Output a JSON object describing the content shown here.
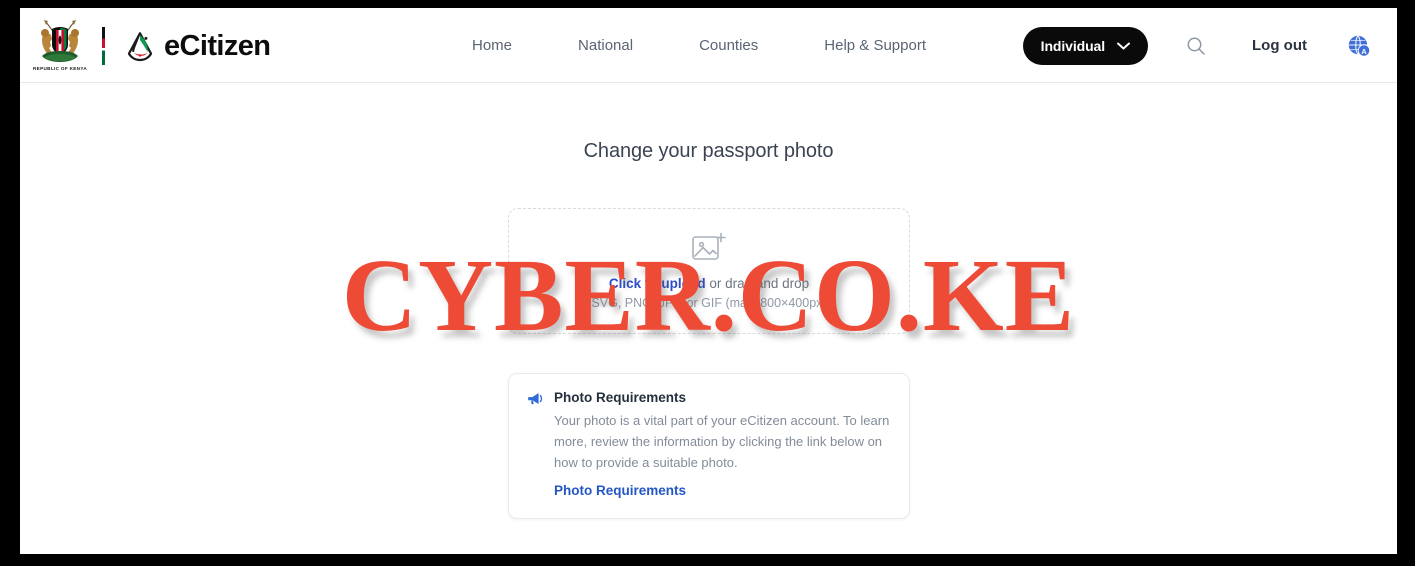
{
  "brand": {
    "coat_caption": "REPUBLIC OF KENYA",
    "wordmark": "eCitizen"
  },
  "nav": {
    "items": [
      {
        "label": "Home"
      },
      {
        "label": "National"
      },
      {
        "label": "Counties"
      },
      {
        "label": "Help & Support"
      }
    ]
  },
  "header_right": {
    "account_type": "Individual",
    "chevron_icon": "chevron-down-icon",
    "search_icon": "search-icon",
    "logout_label": "Log out",
    "globe_icon": "globe-translate-icon"
  },
  "main": {
    "title": "Change your passport photo"
  },
  "dropzone": {
    "icon": "image-add-icon",
    "link_text": "Click to upload",
    "rest_text": " or drag and drop",
    "formats": "SVG, PNG, JPG or GIF (max. 800×400px)"
  },
  "requirements": {
    "icon": "megaphone-icon",
    "title": "Photo Requirements",
    "body": "Your photo is a vital part of your eCitizen account. To learn more, review the information by clicking the link below on how to provide a suitable photo.",
    "link_label": "Photo Requirements"
  },
  "watermark": {
    "text": "CYBER.CO.KE",
    "color": "#ee4b37"
  },
  "colors": {
    "accent_blue": "#2b4cc8",
    "link_blue": "#2457c5",
    "pill_black": "#0a0a0a",
    "text_muted": "#828c99",
    "watermark_red": "#ee4b37"
  }
}
